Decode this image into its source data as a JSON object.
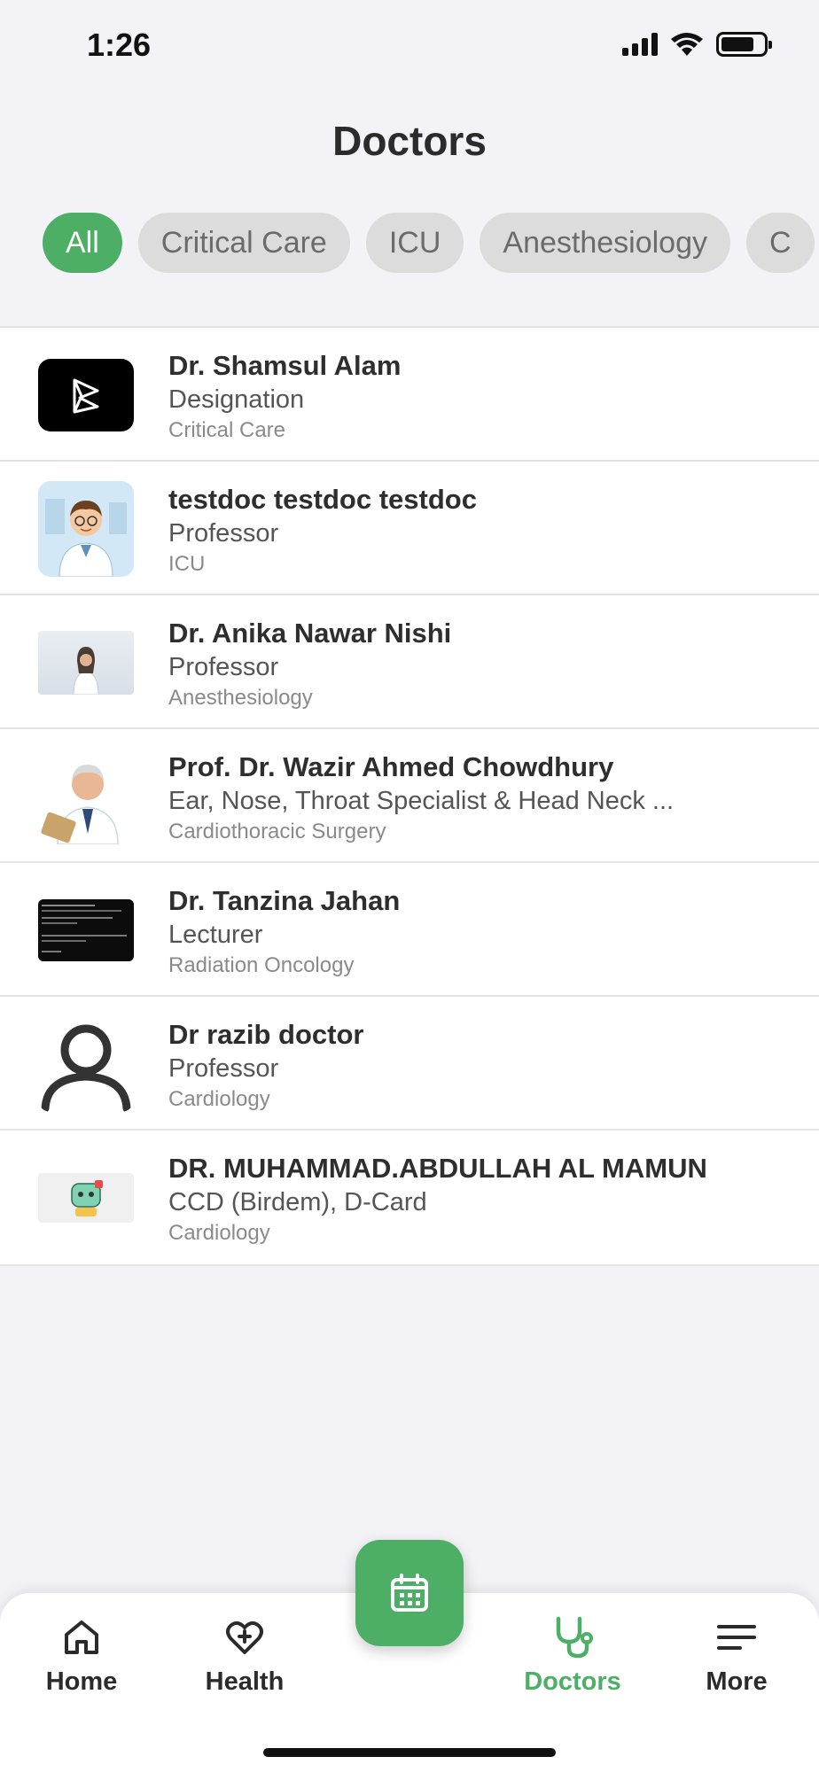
{
  "status_bar": {
    "time": "1:26"
  },
  "header": {
    "title": "Doctors"
  },
  "filters": [
    {
      "label": "All",
      "active": true
    },
    {
      "label": "Critical Care",
      "active": false
    },
    {
      "label": "ICU",
      "active": false
    },
    {
      "label": "Anesthesiology",
      "active": false
    },
    {
      "label": "C",
      "active": false
    }
  ],
  "doctors": [
    {
      "name": "Dr. Shamsul Alam",
      "designation": "Designation",
      "department": "Critical Care",
      "avatar": "logo-icon"
    },
    {
      "name": "testdoc testdoc testdoc",
      "designation": "Professor",
      "department": "ICU",
      "avatar": "cartoon-doctor-avatar"
    },
    {
      "name": "Dr. Anika Nawar Nishi",
      "designation": "Professor",
      "department": "Anesthesiology",
      "avatar": "female-doctor-photo"
    },
    {
      "name": "Prof. Dr. Wazir Ahmed Chowdhury",
      "designation": "Ear, Nose, Throat Specialist & Head Neck ...",
      "department": "Cardiothoracic Surgery",
      "avatar": "male-doctor-photo"
    },
    {
      "name": "Dr. Tanzina Jahan",
      "designation": "Lecturer",
      "department": "Radiation Oncology",
      "avatar": "terminal-screenshot"
    },
    {
      "name": "Dr razib doctor",
      "designation": "Professor",
      "department": "Cardiology",
      "avatar": "person-icon"
    },
    {
      "name": "DR. MUHAMMAD.ABDULLAH AL MAMUN",
      "designation": "CCD (Birdem), D-Card",
      "department": "Cardiology",
      "avatar": "robot-doctor-icon"
    }
  ],
  "bottom_nav": {
    "home": "Home",
    "health": "Health",
    "doctors": "Doctors",
    "more": "More",
    "fab_icon": "calendar-icon"
  },
  "colors": {
    "accent": "#4caf65",
    "chip_bg": "#dcdcdc",
    "background": "#f2f2f7"
  }
}
